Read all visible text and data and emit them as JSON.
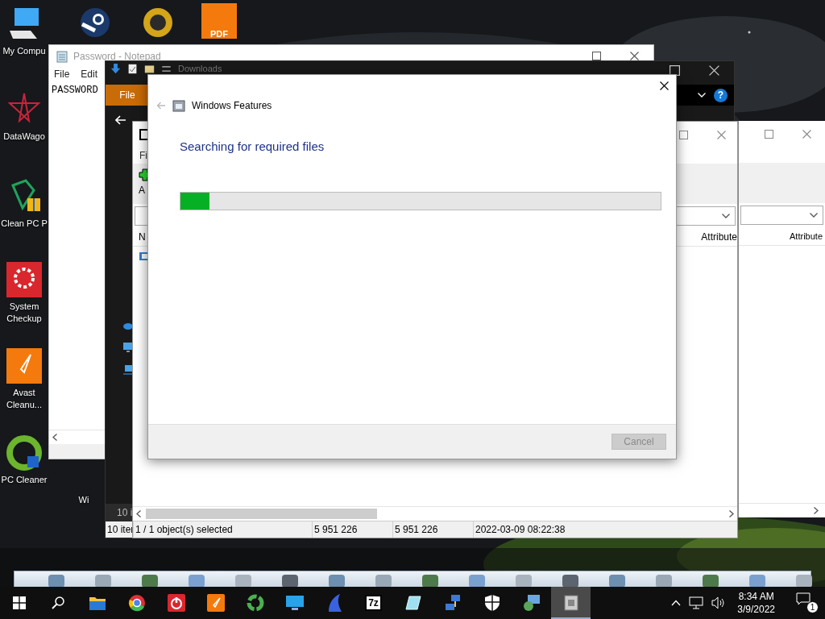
{
  "desktop": {
    "icons": [
      {
        "kind": "computer",
        "label": "My Compu"
      },
      {
        "kind": "knob"
      },
      {
        "kind": "emblem"
      },
      {
        "kind": "pdf",
        "badge": "PDF"
      },
      {
        "kind": "star",
        "label": "DataWago"
      },
      {
        "kind": "broom",
        "label": "Clean PC P"
      },
      {
        "kind": "gear",
        "label": "System Checkup"
      },
      {
        "kind": "rocket",
        "label": "Avast Cleanu..."
      },
      {
        "kind": "leaves",
        "label": "PC Cleaner"
      },
      {
        "kind": "app",
        "label": "Wi"
      }
    ]
  },
  "notepad": {
    "title": "Password - Notepad",
    "menu": [
      "File",
      "Edit"
    ],
    "text": "PASSWORD"
  },
  "explorer": {
    "title": "Downloads",
    "ribbon_tab": "File",
    "help": "?",
    "item_count": "10 i",
    "status": "10 iter"
  },
  "archive_window": {
    "menu": "Fi",
    "toolbar_label": "A",
    "columns": [
      "N",
      "Attribute"
    ],
    "status": [
      "1 / 1 object(s) selected",
      "5 951 226",
      "5 951 226",
      "2022-03-09 08:22:38"
    ]
  },
  "back_window": {
    "columns": [
      "Attribute"
    ]
  },
  "dialog": {
    "title": "Windows Features",
    "heading": "Searching for required files",
    "progress": {
      "level": 0.06
    },
    "cancel": {
      "label": "Cancel",
      "disabled": true
    }
  },
  "taskbar": {
    "apps": [
      {
        "kind": "folder",
        "selected": false
      },
      {
        "kind": "browser",
        "selected": false
      },
      {
        "kind": "power",
        "selected": false
      },
      {
        "kind": "rocket",
        "selected": false
      },
      {
        "kind": "recycle",
        "selected": false
      },
      {
        "kind": "monitor",
        "selected": false
      },
      {
        "kind": "fin",
        "selected": false
      },
      {
        "kind": "archive",
        "label": "7z",
        "selected": false
      },
      {
        "kind": "tablet",
        "selected": false
      },
      {
        "kind": "network",
        "selected": false
      },
      {
        "kind": "shield",
        "selected": false
      },
      {
        "kind": "installer",
        "selected": false
      },
      {
        "kind": "setup",
        "selected": true
      }
    ],
    "time": "8:34 AM",
    "date": "3/9/2022",
    "notifications": "1"
  }
}
